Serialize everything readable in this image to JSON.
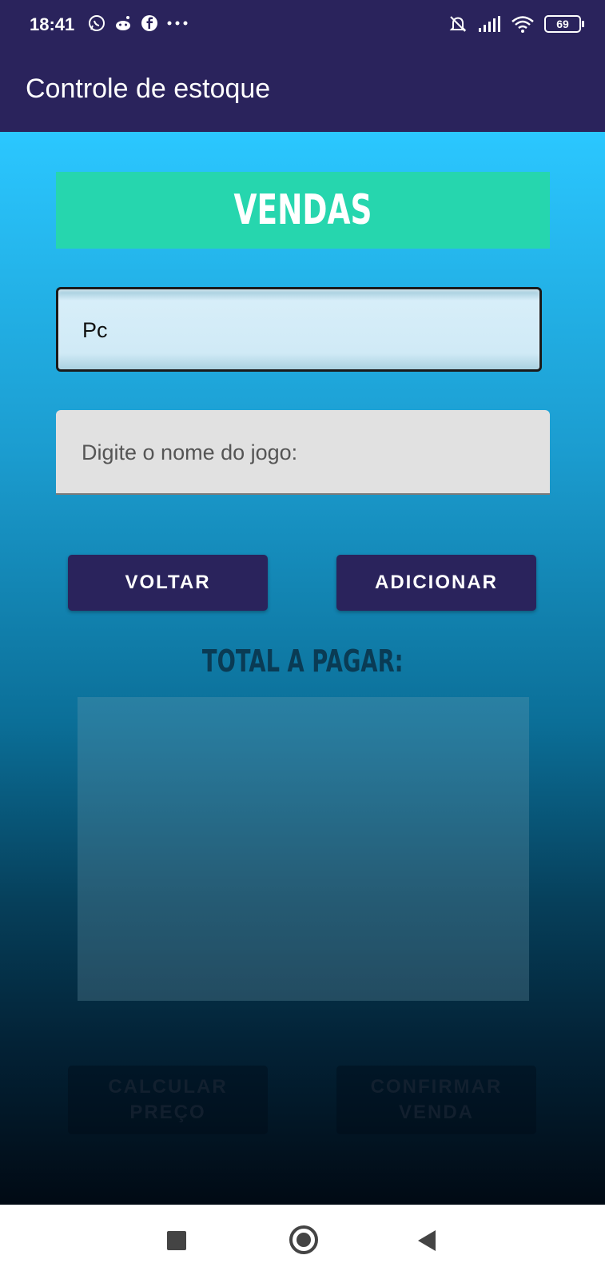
{
  "status_bar": {
    "time": "18:41",
    "battery": "69",
    "left_icons": [
      "whatsapp-icon",
      "reddit-icon",
      "facebook-icon",
      "more-dots-icon"
    ],
    "right_icons": [
      "bell-off-icon",
      "signal-icon",
      "wifi-icon",
      "battery-icon"
    ]
  },
  "app_bar": {
    "title": "Controle de estoque"
  },
  "screen": {
    "banner": "VENDAS",
    "platform_field": {
      "value": "Pc"
    },
    "game_name_field": {
      "placeholder": "Digite o nome do jogo:"
    },
    "buttons": {
      "back": "VOLTAR",
      "add": "ADICIONAR"
    },
    "total_label": "TOTAL A PAGAR:",
    "total_value": "",
    "disabled_buttons": {
      "calculate": "CALCULAR PREÇO",
      "confirm": "CONFIRMAR VENDA"
    }
  },
  "colors": {
    "app_bar": "#2a235c",
    "banner": "#26d6ae",
    "button": "#2a235c",
    "gradient_top": "#2bc7ff",
    "gradient_bottom": "#010a14"
  }
}
